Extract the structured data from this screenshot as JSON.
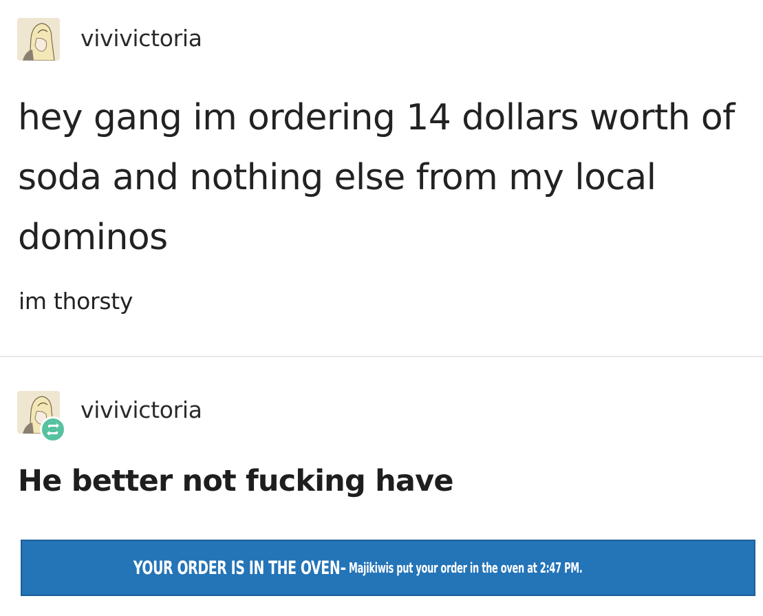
{
  "post_original": {
    "username": "vivivictoria",
    "headline": "hey gang im ordering 14 dollars worth of soda and nothing else from my local dominos",
    "body": "im thorsty",
    "avatar_icon": "anime-avatar-icon"
  },
  "post_reblog": {
    "username": "vivivictoria",
    "reply": "He better not fucking have",
    "avatar_icon": "anime-avatar-icon",
    "badge_icon": "reblog-icon",
    "badge_color": "#56c2a0"
  },
  "order_banner": {
    "headline": "YOUR ORDER IS IN THE OVEN",
    "separator": "-",
    "detail": "Majikiwis put your order in the oven at 2:47 PM.",
    "background_color": "#2474b8"
  }
}
